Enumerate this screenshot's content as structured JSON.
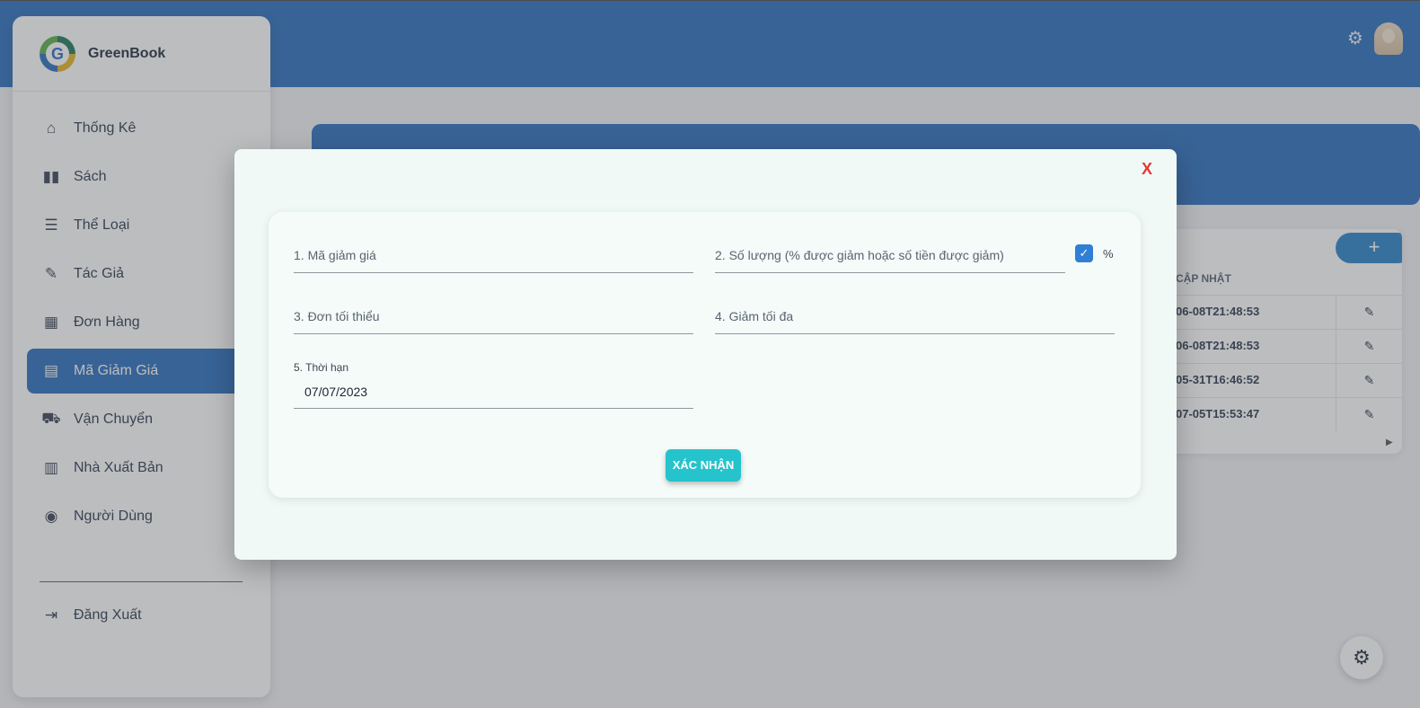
{
  "app": {
    "name": "GreenBook"
  },
  "topbar": {
    "settings_icon": "gear-icon",
    "avatar_icon": "avatar"
  },
  "sidebar": {
    "items": [
      {
        "label": "Thống Kê",
        "icon": "home-icon"
      },
      {
        "label": "Sách",
        "icon": "book-icon"
      },
      {
        "label": "Thể Loại",
        "icon": "list-icon"
      },
      {
        "label": "Tác Giả",
        "icon": "pencil-icon"
      },
      {
        "label": "Đơn Hàng",
        "icon": "table-icon"
      },
      {
        "label": "Mã Giảm Giá",
        "icon": "ticket-icon",
        "active": true
      },
      {
        "label": "Vận Chuyển",
        "icon": "truck-icon"
      },
      {
        "label": "Nhà Xuất Bản",
        "icon": "building-icon"
      },
      {
        "label": "Người Dùng",
        "icon": "user-circle-icon"
      }
    ],
    "logout": {
      "label": "Đăng Xuất",
      "icon": "logout-icon"
    }
  },
  "page": {
    "add_label": "+",
    "column_header": "CẬP NHẬT",
    "rows": [
      {
        "updated": "06-08T21:48:53"
      },
      {
        "updated": "06-08T21:48:53"
      },
      {
        "updated": "05-31T16:46:52"
      },
      {
        "updated": "07-05T15:53:47"
      }
    ]
  },
  "modal": {
    "close_label": "X",
    "fields": {
      "code": {
        "label": "1. Mã giảm giá",
        "value": ""
      },
      "amount": {
        "label": "2. Số lượng (% được giảm hoặc số tiền được giảm)",
        "value": ""
      },
      "min_order": {
        "label": "3. Đơn tối thiểu",
        "value": ""
      },
      "max_discount": {
        "label": "4. Giảm tối đa",
        "value": ""
      },
      "expiry": {
        "label": "5. Thời hạn",
        "value": "07/07/2023"
      }
    },
    "percent_checkbox": {
      "checked": true,
      "label": "%"
    },
    "confirm_label": "XÁC NHẬN"
  },
  "colors": {
    "primary": "#2a6ebd",
    "confirm": "#25c3cc",
    "close": "#e53935",
    "checkbox": "#2f7fd6"
  }
}
